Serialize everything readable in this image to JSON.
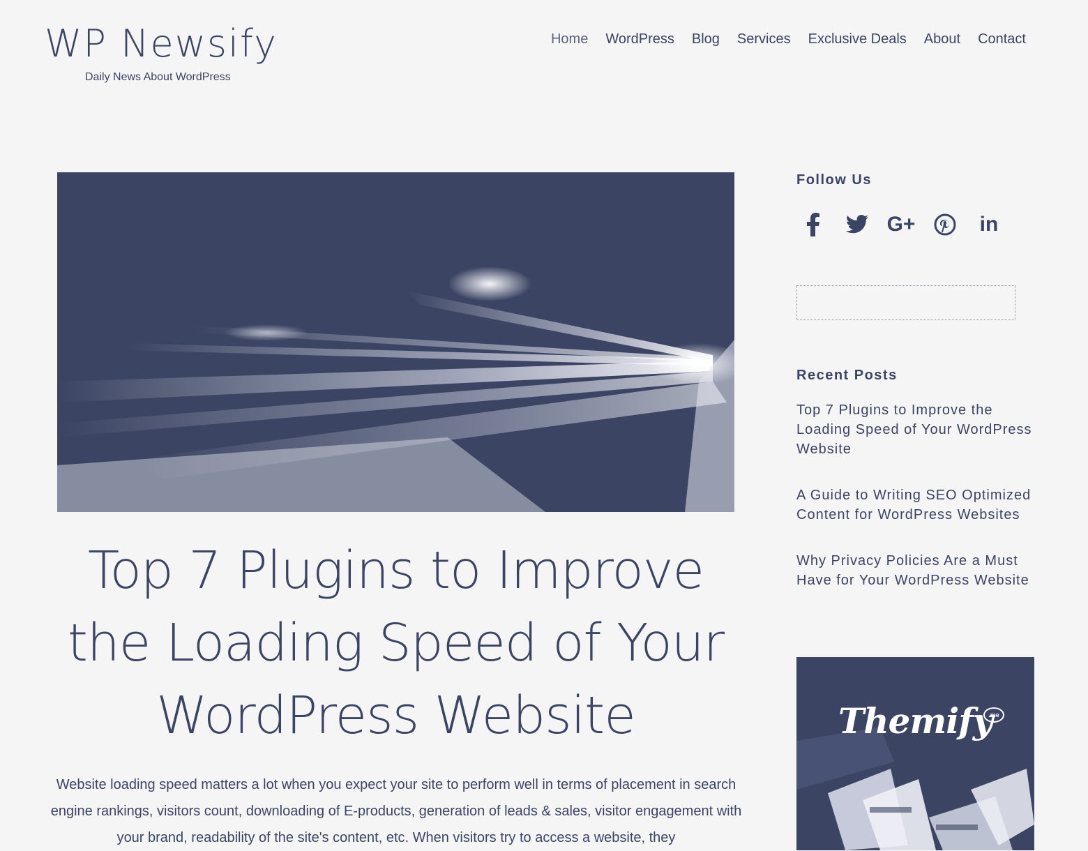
{
  "header": {
    "site_title": "WP Newsify",
    "tagline": "Daily News About WordPress",
    "nav": [
      {
        "label": "Home"
      },
      {
        "label": "WordPress"
      },
      {
        "label": "Blog"
      },
      {
        "label": "Services"
      },
      {
        "label": "Exclusive Deals"
      },
      {
        "label": "About"
      },
      {
        "label": "Contact"
      }
    ]
  },
  "post": {
    "title": "Top 7 Plugins to Improve the Loading Speed of Your WordPress Website",
    "excerpt": "Website loading speed matters a lot when you expect your site to perform well in terms of placement in search engine rankings, visitors count, downloading of E-products, generation of leads & sales, visitor engagement with your brand, readability of the site's content, etc. When visitors try to access a website, they"
  },
  "sidebar": {
    "follow_title": "Follow Us",
    "social": [
      {
        "icon": "facebook-icon"
      },
      {
        "icon": "twitter-icon"
      },
      {
        "icon": "google-plus-icon",
        "text": "G+"
      },
      {
        "icon": "pinterest-icon"
      },
      {
        "icon": "linkedin-icon",
        "text": "in"
      }
    ],
    "search": {
      "value": "",
      "placeholder": ""
    },
    "recent_title": "Recent Posts",
    "recent_posts": [
      {
        "label": "Top 7 Plugins to Improve the Loading Speed of Your WordPress Website"
      },
      {
        "label": "A Guide to Writing SEO Optimized Content for WordPress Websites"
      },
      {
        "label": "Why Privacy Policies Are a Must Have for Your WordPress Website"
      }
    ],
    "ad": {
      "logo_text": "Themify",
      "badge": ".me"
    }
  },
  "colors": {
    "primary": "#3b4463",
    "background": "#f5f5f6"
  }
}
